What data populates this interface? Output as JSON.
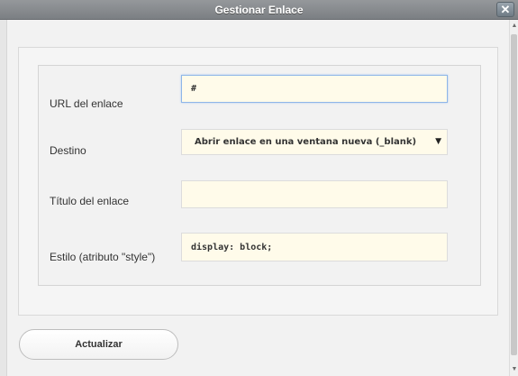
{
  "dialog": {
    "title": "Gestionar Enlace",
    "close_icon": "close-icon",
    "close_glyph": "✕"
  },
  "form": {
    "url": {
      "label": "URL del enlace",
      "value": "#"
    },
    "target": {
      "label": "Destino",
      "selected": "Abrir enlace en una ventana nueva (_blank)",
      "arrow": "▼"
    },
    "title": {
      "label": "Título del enlace",
      "value": ""
    },
    "style": {
      "label": "Estilo (atributo \"style\")",
      "value": "display: block;"
    }
  },
  "actions": {
    "update_label": "Actualizar"
  },
  "scrollbar": {
    "up": "▲",
    "down": "▼"
  }
}
